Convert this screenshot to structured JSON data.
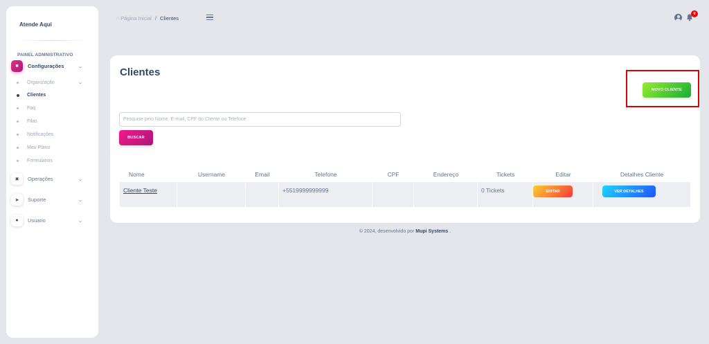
{
  "sidebar": {
    "brand": "Atende Aqui",
    "section_title": "PAINEL ADMNISTRATIVO",
    "main_items": [
      {
        "label": "Configurações",
        "icon": "home-icon"
      },
      {
        "label": "Operações",
        "icon": "tools-icon"
      },
      {
        "label": "Suporte",
        "icon": "rocket-icon"
      },
      {
        "label": "Usuario",
        "icon": "user-plus-icon"
      }
    ],
    "sub_items": [
      {
        "label": "Organização",
        "has_children": true
      },
      {
        "label": "Clientes",
        "active": true
      },
      {
        "label": "Faq"
      },
      {
        "label": "Filas"
      },
      {
        "label": "Notificações"
      },
      {
        "label": "Meu Plano"
      },
      {
        "label": "Formularios"
      }
    ]
  },
  "topbar": {
    "breadcrumb_home": "Página Inicial",
    "breadcrumb_sep": "/",
    "breadcrumb_current": "Clientes",
    "notification_count": "0"
  },
  "main": {
    "title": "Clientes",
    "new_client_label": "NOVO CLIENTE",
    "search_placeholder": "Pesquise pelo Nome, E-mail, CPF do Cliente ou Telefone",
    "search_value": "",
    "search_button_label": "BUSCAR",
    "columns": [
      "Nome",
      "Username",
      "Email",
      "Telefone",
      "CPF",
      "Endereço",
      "Tickets",
      "Editar",
      "Detalhes Cliente"
    ],
    "rows": [
      {
        "nome": "Cliente Teste",
        "username": "",
        "email": "",
        "telefone": "+5519999999999",
        "cpf": "",
        "endereco": "",
        "tickets": "0 Tickets",
        "edit_label": "EDITAR",
        "details_label": "VER DETALHES"
      }
    ]
  },
  "footer": {
    "prefix": "© 2024, desenvolvido por",
    "company": "Mupi Systems",
    "suffix": "."
  },
  "colors": {
    "background": "#e4e6eb",
    "primary_text": "#344767",
    "pink_gradient_start": "#f0198a",
    "green_gradient_start": "#98ec2d",
    "orange_gradient_start": "#fbcf33",
    "blue_gradient_start": "#21d4fd",
    "highlight_border": "#e00000",
    "badge": "#ea0606"
  }
}
